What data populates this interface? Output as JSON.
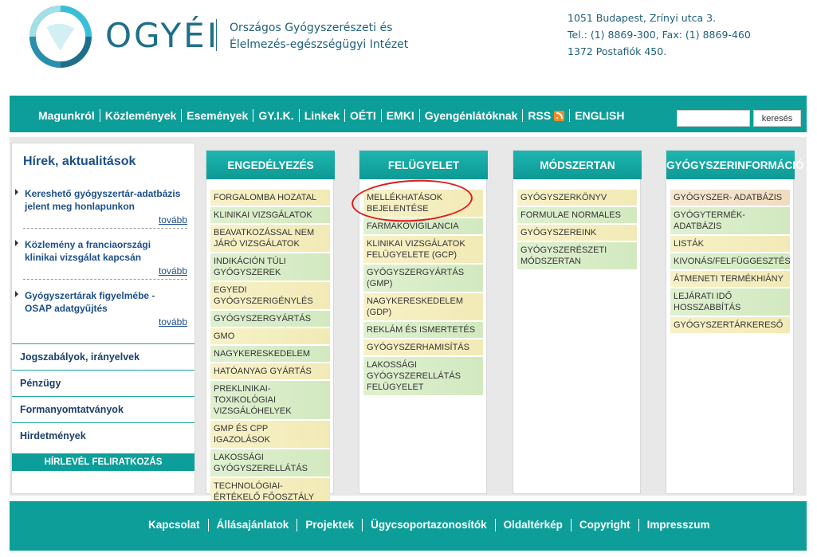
{
  "header": {
    "brand": "OGYÉI",
    "institute_line1": "Országos Gyógyszerészeti és",
    "institute_line2": "Élelmezés-egészségügyi Intézet",
    "address_line1": "1051 Budapest, Zrínyi utca 3.",
    "address_line2": "Tel.: (1) 8869-300, Fax: (1) 8869-460",
    "address_line3": "1372 Postafiók 450.",
    "logo_icon": "ring-logo-icon"
  },
  "nav": {
    "items": [
      "Magunkról",
      "Közlemények",
      "Események",
      "GY.I.K.",
      "Linkek",
      "OÉTI",
      "EMKI",
      "Gyengénlátóknak",
      "RSS",
      "ENGLISH"
    ],
    "rss_icon": "rss-icon",
    "search_button": "keresés",
    "search_value": ""
  },
  "sidebar": {
    "news_title": "Hírek, aktualitások",
    "news": [
      {
        "headline": "Kereshető gyógyszertár-adatbázis jelent meg honlapunkon",
        "more": "tovább"
      },
      {
        "headline": "Közlemény a franciaországi klinikai vizsgálat kapcsán",
        "more": "tovább"
      },
      {
        "headline": "Gyógyszertárak figyelmébe - OSAP adatgyűjtés",
        "more": "tovább"
      }
    ],
    "links": [
      "Jogszabályok, irányelvek",
      "Pénzügy",
      "Formanyomtatványok",
      "Hirdetmények"
    ],
    "newsletter": "HÍRLEVÉL FELIRATKOZÁS"
  },
  "columns": [
    {
      "title": "ENGEDÉLYEZÉS",
      "items": [
        "FORGALOMBA HOZATAL",
        "KLINIKAI VIZSGÁLATOK",
        "BEAVATKOZÁSSAL NEM JÁRÓ VIZSGÁLATOK",
        "INDIKÁCIÓN TÚLI GYÓGYSZEREK",
        "EGYEDI GYÓGYSZERIGÉNYLÉS",
        "GYÓGYSZERGYÁRTÁS",
        "GMO",
        "NAGYKERESKEDELEM",
        "HATÓANYAG GYÁRTÁS",
        "PREKLINIKAI-TOXIKOLÓGIAI VIZSGÁLÓHELYEK",
        "GMP ÉS CPP IGAZOLÁSOK",
        "LAKOSSÁGI GYÓGYSZERELLÁTÁS",
        "TECHNOLÓGIAI-ÉRTÉKELŐ FŐOSZTÁLY"
      ]
    },
    {
      "title": "FELÜGYELET",
      "items": [
        "MELLÉKHATÁSOK BEJELENTÉSE",
        "FARMAKOVIGILANCIA",
        "KLINIKAI VIZSGÁLATOK FELÜGYELETE (GCP)",
        "GYÓGYSZERGYÁRTÁS (GMP)",
        "NAGYKERESKEDELEM (GDP)",
        "REKLÁM ÉS ISMERTETÉS",
        "GYÓGYSZERHAMISÍTÁS",
        "LAKOSSÁGI GYÓGYSZERELLÁTÁS FELÜGYELET"
      ]
    },
    {
      "title": "MÓDSZERTAN",
      "items": [
        "GYÓGYSZERKÖNYV",
        "FORMULAE NORMALES",
        "GYÓGYSZEREINK",
        "GYÓGYSZERÉSZETI MÓDSZERTAN"
      ]
    },
    {
      "title": "GYÓGYSZERINFORMÁCIÓ",
      "items": [
        "GYÓGYSZER- ADATBÁZIS",
        "GYÓGYTERMÉK-ADATBÁZIS",
        "LISTÁK",
        "KIVONÁS/FELFÜGGESZTÉS",
        "ÁTMENETI TERMÉKHIÁNY",
        "LEJÁRATI IDŐ HOSSZABBÍTÁS",
        "GYÓGYSZERTÁRKERESŐ"
      ]
    }
  ],
  "footer": {
    "items": [
      "Kapcsolat",
      "Állásajánlatok",
      "Projektek",
      "Ügycsoportazonosítók",
      "Oldaltérkép",
      "Copyright",
      "Impresszum"
    ]
  },
  "colors": {
    "teal": "#0d9e99",
    "navy": "#1b4f8a",
    "highlight": "#e01b1b"
  }
}
